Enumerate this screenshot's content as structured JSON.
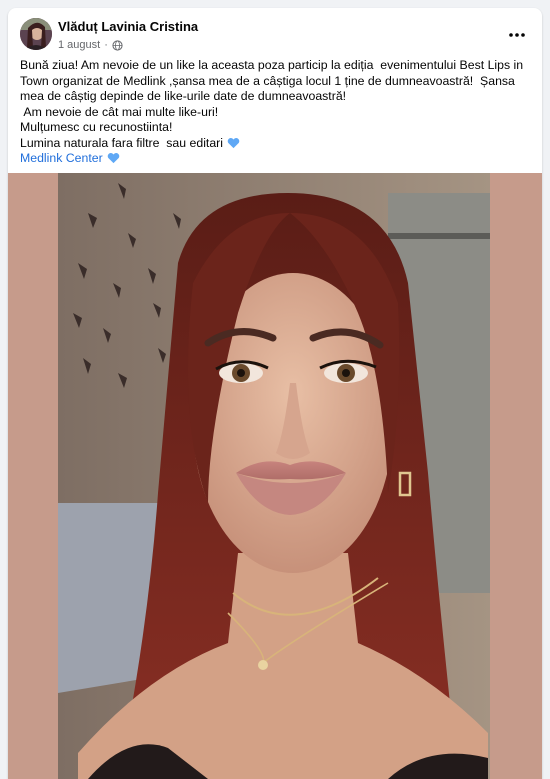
{
  "post": {
    "author": "Vlăduț Lavinia Cristina",
    "date": "1 august",
    "separator": "·",
    "privacy_icon": "globe-icon",
    "more_icon": "more-options-icon",
    "text_lines": [
      "Bună ziua! Am nevoie de un like la aceasta poza particip la ediția  evenimentului Best Lips in Town organizat de Medlink ,șansa mea de a câștiga locul 1 ține de dumneavoastră!  Șansa mea de câștig depinde de like-urile date de dumneavoastră!",
      " Am nevoie de cât mai multe like-uri!",
      "Mulțumesc cu recunostiinta!",
      "Lumina naturala fara filtre  sau editari"
    ],
    "heart_icon": "blue-heart-icon",
    "link": "Medlink Center",
    "photo_description_icon": "selfie-photo"
  },
  "colors": {
    "link": "#216fdb",
    "heart": "#5fa8f5",
    "media_background": "#c69b8b"
  }
}
